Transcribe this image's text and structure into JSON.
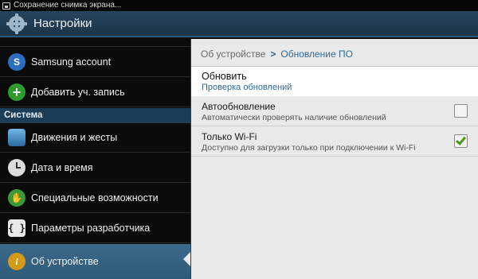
{
  "status_bar": {
    "notification": "Сохранение снимка экрана..."
  },
  "action_bar": {
    "title": "Настройки"
  },
  "sidebar": {
    "items_top": [
      {
        "label": "Samsung account",
        "icon": "samsung-account-icon"
      },
      {
        "label": "Добавить уч. запись",
        "icon": "add-account-icon"
      }
    ],
    "section_title": "Система",
    "items_system": [
      {
        "label": "Движения и жесты",
        "icon": "motion-icon"
      },
      {
        "label": "Дата и время",
        "icon": "clock-icon"
      },
      {
        "label": "Специальные возможности",
        "icon": "accessibility-icon"
      },
      {
        "label": "Параметры разработчика",
        "icon": "developer-options-icon"
      },
      {
        "label": "Об устройстве",
        "icon": "info-icon",
        "selected": true
      }
    ]
  },
  "breadcrumb": {
    "parent": "Об устройстве",
    "separator": ">",
    "current": "Обновление ПО"
  },
  "update_item": {
    "title": "Обновить",
    "subtitle": "Проверка обновлений"
  },
  "settings": [
    {
      "title": "Автообновление",
      "subtitle": "Автоматически проверять наличие обновлений",
      "checked": false
    },
    {
      "title": "Только Wi-Fi",
      "subtitle": "Доступно для загрузки только при подключении к Wi-Fi",
      "checked": true
    }
  ],
  "colors": {
    "accent": "#2f6b96",
    "section": "#1c3d58",
    "selected": "#3c6a8a",
    "check": "#4a9a1a"
  }
}
